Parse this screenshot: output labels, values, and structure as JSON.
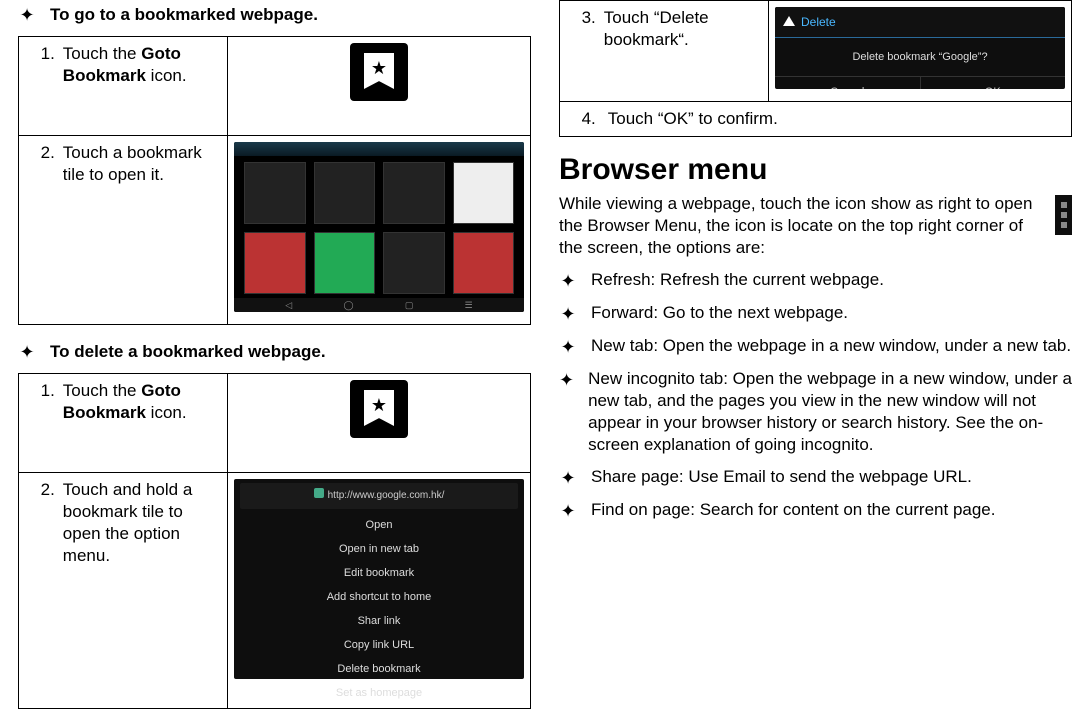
{
  "left": {
    "section1_title": "To go to a bookmarked webpage.",
    "s1_step1_num": "1.",
    "s1_step1_pre": "Touch the ",
    "s1_step1_bold": "Goto Bookmark",
    "s1_step1_post": " icon.",
    "s1_step2_num": "2.",
    "s1_step2_txt": "Touch a bookmark tile to open it.",
    "section2_title": "To delete a bookmarked webpage.",
    "s2_step1_num": "1.",
    "s2_step1_pre": "Touch the ",
    "s2_step1_bold": "Goto Bookmark",
    "s2_step1_post": " icon.",
    "s2_step2_num": "2.",
    "s2_step2_txt": "Touch and hold a bookmark tile to open the option menu."
  },
  "right": {
    "s3_num": "3.",
    "s3_txt": "Touch “Delete bookmark“.",
    "s4_num": "4.",
    "s4_txt": "Touch “OK” to confirm.",
    "heading": "Browser menu",
    "para": "While viewing a webpage, touch the icon show as right to open the Browser Menu, the icon is locate on the top right corner of the screen, the options are:",
    "items": [
      "Refresh: Refresh the current webpage.",
      "Forward: Go to the next webpage.",
      "New tab: Open the webpage in a new window, under a new tab.",
      "New incognito tab: Open the webpage in a new window, under a new tab, and the pages you view in the new window will not appear in your browser history or search history. See the on-screen explanation of going incognito.",
      "Share page: Use Email to send the webpage URL.",
      "Find on page: Search for content on the current page."
    ]
  },
  "ctx_menu": {
    "url": "http://www.google.com.hk/",
    "opts": [
      "Open",
      "Open in new tab",
      "Edit bookmark",
      "Add shortcut to home",
      "Shar link",
      "Copy link URL",
      "Delete bookmark",
      "Set as homepage"
    ]
  },
  "del_dlg": {
    "title": "Delete",
    "msg": "Delete bookmark “Google”?",
    "cancel": "Cancel",
    "ok": "OK"
  },
  "navbar_glyphs": [
    "◁",
    "◯",
    "▢",
    "☰"
  ]
}
